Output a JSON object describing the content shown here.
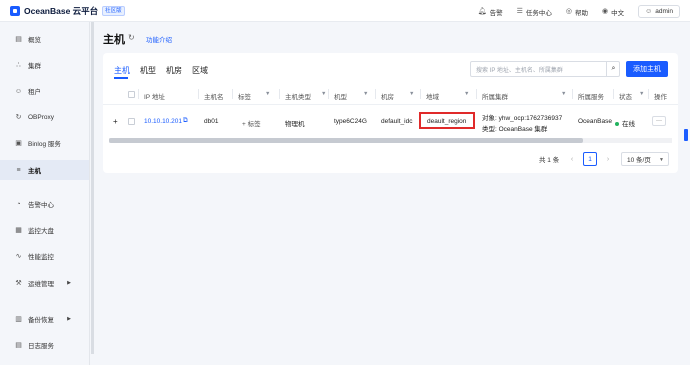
{
  "topbar": {
    "logo_text": "OceanBase 云平台",
    "edition_badge": "社区版",
    "alerts": "告警",
    "tasks": "任务中心",
    "help": "帮助",
    "language": "中文",
    "user": "admin"
  },
  "sidebar": {
    "items": [
      {
        "label": "概览",
        "icon": "overview-icon"
      },
      {
        "label": "集群",
        "icon": "cluster-icon"
      },
      {
        "label": "租户",
        "icon": "tenant-icon"
      },
      {
        "label": "OBProxy",
        "icon": "proxy-icon"
      },
      {
        "label": "Binlog 服务",
        "icon": "binlog-icon"
      },
      {
        "label": "主机",
        "icon": "host-icon",
        "active": true
      },
      {
        "label": "告警中心",
        "icon": "alarm-icon"
      },
      {
        "label": "监控大盘",
        "icon": "dashboard-icon"
      },
      {
        "label": "性能监控",
        "icon": "performance-icon"
      },
      {
        "label": "运维管理",
        "icon": "ops-icon",
        "has_submenu": true
      },
      {
        "label": "备份恢复",
        "icon": "backup-icon",
        "has_submenu": true
      },
      {
        "label": "日志服务",
        "icon": "log-icon"
      }
    ]
  },
  "page": {
    "title": "主机",
    "help_link": "功能介绍"
  },
  "tabs": [
    "主机",
    "机型",
    "机房",
    "区域"
  ],
  "search": {
    "placeholder": "搜索 IP 地址、主机名、所属集群"
  },
  "add_button": "添加主机",
  "table": {
    "columns": [
      "IP 地址",
      "主机名",
      "标签",
      "主机类型",
      "机型",
      "机房",
      "地域",
      "所属集群",
      "所属服务",
      "状态",
      "操作"
    ],
    "rows": [
      {
        "expand": "+",
        "ip": "10.10.10.201",
        "hostname": "db01",
        "tag": "+ 标签",
        "host_type": "物理机",
        "model": "type6C24G",
        "idc": "default_idc",
        "region": "deault_region",
        "cluster_object": "对象: yhw_ocp:1762736937",
        "cluster_type": "类型: OceanBase 集群",
        "service": "OceanBase",
        "status": "在线",
        "action": "···"
      }
    ]
  },
  "pagination": {
    "total": "共 1 条",
    "current_page": "1",
    "page_size": "10 条/页"
  },
  "colors": {
    "accent": "#1a5cff",
    "highlight_box": "#e02a2a",
    "status_online": "#22b35e"
  }
}
